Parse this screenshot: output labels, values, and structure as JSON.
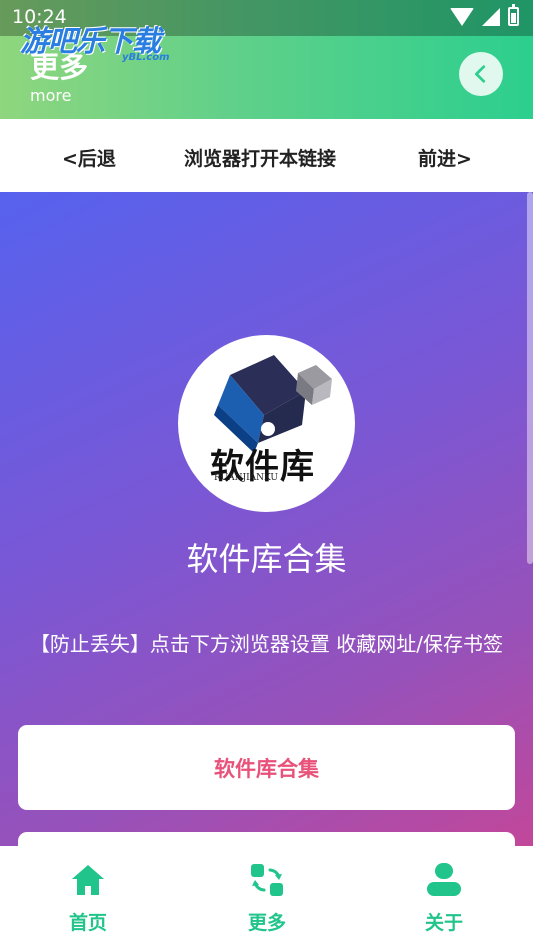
{
  "status": {
    "time": "10:24"
  },
  "watermark": {
    "text": "游吧乐下载",
    "sub": "yBL.com"
  },
  "header": {
    "title": "更多",
    "subtitle": "more"
  },
  "nav": {
    "back": "<后退",
    "open_browser": "浏览器打开本链接",
    "forward": "前进>"
  },
  "logo": {
    "label": "软件库",
    "sublabel": "RUANJIANKU"
  },
  "main": {
    "title": "软件库合集",
    "notice": "【防止丢失】点击下方浏览器设置 收藏网址/保存书签",
    "button_label": "软件库合集"
  },
  "tabs": [
    {
      "label": "首页",
      "icon": "home-icon"
    },
    {
      "label": "更多",
      "icon": "more-icon"
    },
    {
      "label": "关于",
      "icon": "user-icon"
    }
  ],
  "colors": {
    "accent": "#21c48a",
    "button_text": "#e8527a",
    "header_start": "#8fd67e",
    "header_end": "#2ccf8e"
  }
}
